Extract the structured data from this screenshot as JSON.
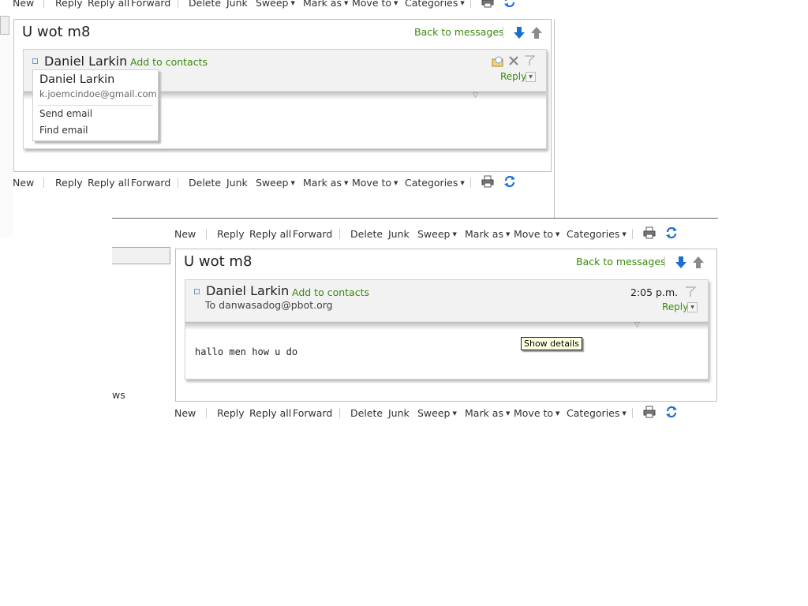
{
  "toolbar": {
    "new": "New",
    "reply": "Reply",
    "reply_all": "Reply all",
    "forward": "Forward",
    "delete": "Delete",
    "junk": "Junk",
    "sweep": "Sweep",
    "mark_as": "Mark as",
    "move_to": "Move to",
    "categories": "Categories",
    "print_icon": "print-icon",
    "refresh_icon": "refresh-icon"
  },
  "message": {
    "subject": "U wot m8",
    "back_link": "Back to messages",
    "sender_name": "Daniel Larkin",
    "add_contacts": "Add to contacts",
    "to_line": "To danwasadog@pbot.org",
    "time": "2:05 p.m.",
    "reply_label": "Reply",
    "body": "hallo men how u do",
    "show_details_tooltip": "Show details"
  },
  "contact_popup": {
    "name": "Daniel Larkin",
    "email": "k.joemcindoe@gmail.com",
    "send_email": "Send email",
    "find_email": "Find email"
  },
  "sidebar_fragment": {
    "text": "ws"
  },
  "colors": {
    "link_green": "#3a8a0e",
    "arrow_blue": "#1a6fd0",
    "header_bg": "#f2f2f2"
  }
}
